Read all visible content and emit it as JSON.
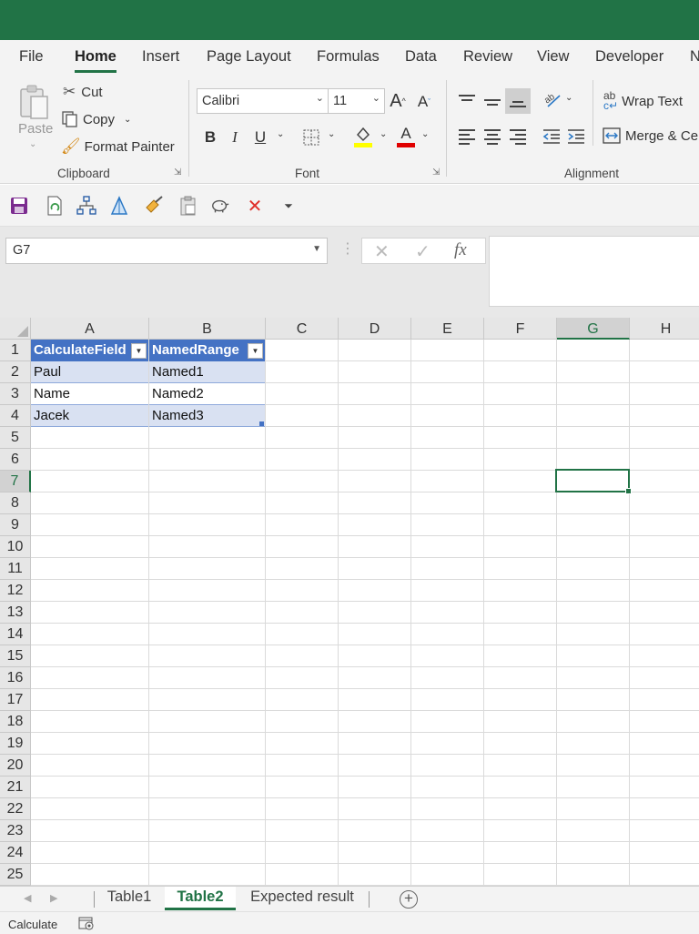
{
  "app": {
    "accent": "#217346"
  },
  "menu": {
    "tabs": [
      "File",
      "Home",
      "Insert",
      "Page Layout",
      "Formulas",
      "Data",
      "Review",
      "View",
      "Developer",
      "N"
    ],
    "active": "Home"
  },
  "ribbon": {
    "clipboard": {
      "paste": "Paste",
      "cut": "Cut",
      "copy": "Copy",
      "format_painter": "Format Painter",
      "group_label": "Clipboard"
    },
    "font": {
      "family": "Calibri",
      "size": "11",
      "bold": "B",
      "italic": "I",
      "underline": "U",
      "grow": "A",
      "shrink": "A",
      "font_color": "A",
      "group_label": "Font"
    },
    "alignment": {
      "wrap_text": "Wrap Text",
      "merge": "Merge & Ce",
      "group_label": "Alignment"
    }
  },
  "quick_access": {
    "icons": [
      "save-icon",
      "refresh-sheet-icon",
      "hierarchy-icon",
      "triangle-icon",
      "format-brush-icon",
      "paste-icon",
      "piggy-bank-icon",
      "close-red-icon",
      "customize-dropdown-icon"
    ]
  },
  "formula_bar": {
    "name_box": "G7",
    "cancel": "✕",
    "enter": "✓",
    "fx": "fx",
    "formula": ""
  },
  "grid": {
    "columns": [
      "A",
      "B",
      "C",
      "D",
      "E",
      "F",
      "G",
      "H"
    ],
    "rows": [
      "1",
      "2",
      "3",
      "4",
      "5",
      "6",
      "7",
      "8",
      "9",
      "10",
      "11",
      "12",
      "13",
      "14",
      "15",
      "16",
      "17",
      "18",
      "19",
      "20",
      "21",
      "22",
      "23",
      "24",
      "25"
    ],
    "selected_column": "G",
    "selected_row": "7",
    "table": {
      "headers": [
        "CalculateField",
        "NamedRange"
      ],
      "rows": [
        [
          "Paul",
          "Named1"
        ],
        [
          "Name",
          "Named2"
        ],
        [
          "Jacek",
          "Named3"
        ]
      ],
      "header_color": "#4472c4",
      "band_color": "#d9e1f2"
    }
  },
  "sheets": {
    "tabs": [
      "Table1",
      "Table2",
      "Expected result"
    ],
    "active": "Table2"
  },
  "status": {
    "text": "Calculate"
  }
}
